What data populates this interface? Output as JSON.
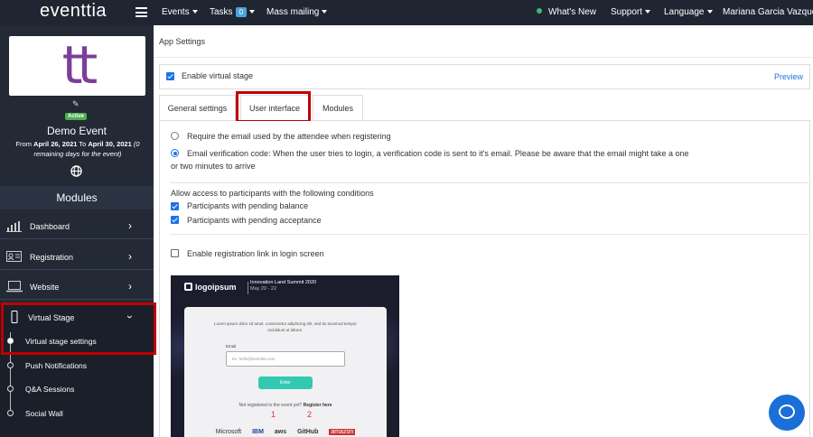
{
  "topbar": {
    "logo": "eventtia",
    "nav": {
      "events": "Events",
      "tasks": "Tasks",
      "tasks_count": "0",
      "mass_mailing": "Mass mailing",
      "whats_new": "What's New",
      "support": "Support",
      "language": "Language",
      "user": "Mariana Garcia Vazquez"
    }
  },
  "sidebar": {
    "logo_text": "tt",
    "status": "Active",
    "event_name": "Demo Event",
    "dates": {
      "from_label": "From",
      "from": "April 26, 2021",
      "to_label": "To",
      "to": "April 30, 2021",
      "remaining": "(0 remaining days for the event)"
    },
    "modules_title": "Modules",
    "items": [
      {
        "label": "Dashboard",
        "icon": "chart-icon"
      },
      {
        "label": "Registration",
        "icon": "id-card-icon"
      },
      {
        "label": "Website",
        "icon": "laptop-icon"
      },
      {
        "label": "Virtual Stage",
        "icon": "mobile-icon"
      }
    ],
    "subitems": [
      {
        "label": "Virtual stage settings"
      },
      {
        "label": "Push Notifications"
      },
      {
        "label": "Q&A Sessions"
      },
      {
        "label": "Social Wall"
      }
    ]
  },
  "main": {
    "breadcrumb": "App Settings",
    "enable_virtual_stage": "Enable virtual stage",
    "preview": "Preview",
    "tabs": [
      {
        "label": "General settings"
      },
      {
        "label": "User interface"
      },
      {
        "label": "Modules"
      }
    ],
    "radio_require_email": "Require the email used by the attendee when registering",
    "radio_verification_line1": "Email verification code: When the user tries to login, a verification code is sent to it's email. Please be aware that the email might take a one",
    "radio_verification_line2": "or two minutes to arrive",
    "access_title": "Allow access to participants with the following conditions",
    "pending_balance": "Participants with pending balance",
    "pending_acceptance": "Participants with pending acceptance",
    "enable_reg_link": "Enable registration link in login screen"
  },
  "preview_image": {
    "logo": "logoipsum",
    "title": "Innovation Land Summit 2020",
    "dates": "May 20 - 22",
    "description": "Lorem ipsum dolor sit amet, consectetur adipiscing elit, sed do eiusmod tempor incididunt ut labore.",
    "email_label": "Email",
    "email_placeholder": "Ex: hello@eventtia.com",
    "enter_button": "Enter",
    "not_registered": "Not registered to the event yet?",
    "register_here": "Register here",
    "marker_1": "1",
    "marker_2": "2",
    "brands": [
      "Microsoft",
      "IBM",
      "aws",
      "GitHub",
      "amazon"
    ]
  }
}
